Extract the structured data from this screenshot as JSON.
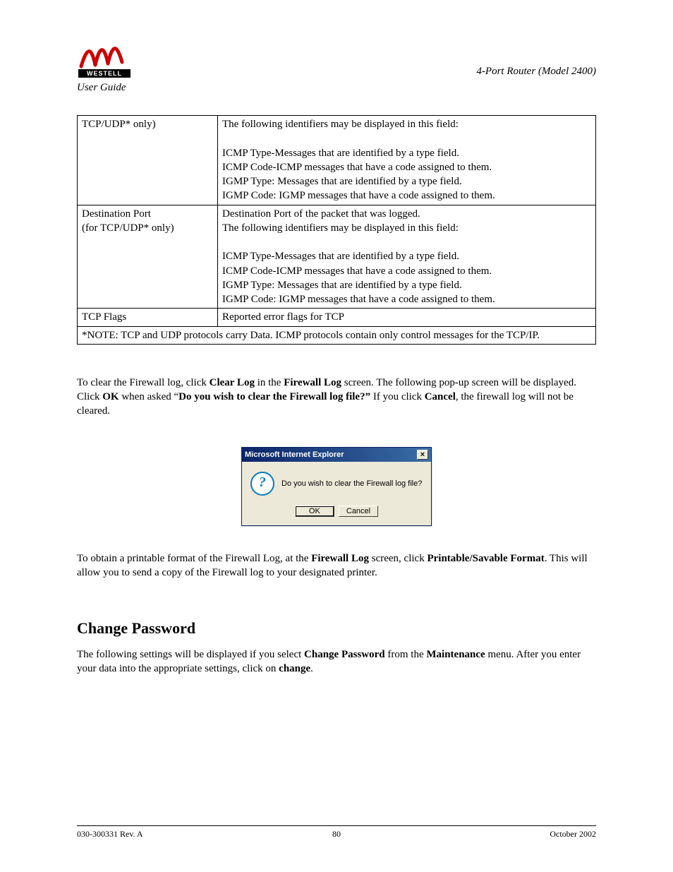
{
  "header": {
    "logo_text": "WESTELL",
    "left": "User Guide",
    "right": "4-Port Router (Model 2400)"
  },
  "table": {
    "row1": {
      "col1": "TCP/UDP* only)",
      "col2_line1": "The following identifiers may be displayed in this field:",
      "col2_line2": "ICMP Type-Messages that are identified by a type field.",
      "col2_line3": "ICMP Code-ICMP messages that have a code assigned to them.",
      "col2_line4": "IGMP Type: Messages that are identified by a type field.",
      "col2_line5": "IGMP Code: IGMP messages that have a code assigned to them."
    },
    "row2": {
      "col1_line1": "Destination Port",
      "col1_line2": "(for TCP/UDP* only)",
      "col2_line0": "Destination Port of the packet that was logged.",
      "col2_line1": "The following identifiers may be displayed in this field:",
      "col2_line2": "ICMP Type-Messages that are identified by a type field.",
      "col2_line3": "ICMP Code-ICMP messages that have a code assigned to them.",
      "col2_line4": "IGMP Type: Messages that are identified by a type field.",
      "col2_line5": "IGMP Code: IGMP messages that have a code assigned to them."
    },
    "row3": {
      "col1": "TCP Flags",
      "col2": "Reported error flags for TCP"
    },
    "note": "*NOTE: TCP and UDP protocols carry Data. ICMP protocols contain only control messages for the TCP/IP."
  },
  "para1": {
    "t1": "To clear the Firewall log, click ",
    "b1": "Clear Log",
    "t2": " in the ",
    "b2": "Firewall Log",
    "t3": " screen. The following pop-up screen will be displayed. Click ",
    "b3": "OK",
    "t4": " when asked “",
    "b4": "Do you wish to clear the Firewall log file?”",
    "t5": " If you click ",
    "b5": "Cancel",
    "t6": ", the firewall log will not be cleared."
  },
  "dialog": {
    "title": "Microsoft Internet Explorer",
    "close_glyph": "×",
    "question_glyph": "?",
    "message": "Do you wish to clear the Firewall log file?",
    "ok": "OK",
    "cancel": "Cancel"
  },
  "para2": {
    "t1": "To obtain a printable format of the Firewall Log, at the ",
    "b1": "Firewall Log",
    "t2": " screen, click ",
    "b2": "Printable/Savable Format",
    "t3": ". This will allow you to send a copy of the Firewall log to your designated printer."
  },
  "section_heading": "Change Password",
  "para3": {
    "t1": "The following settings will be displayed if you select ",
    "b1": "Change Password",
    "t2": " from the ",
    "b2": "Maintenance",
    "t3": " menu. After you enter your data into the appropriate settings, click on ",
    "b3": "change",
    "t4": "."
  },
  "footer": {
    "left": "030-300331 Rev. A",
    "center": "80",
    "right": "October 2002"
  }
}
